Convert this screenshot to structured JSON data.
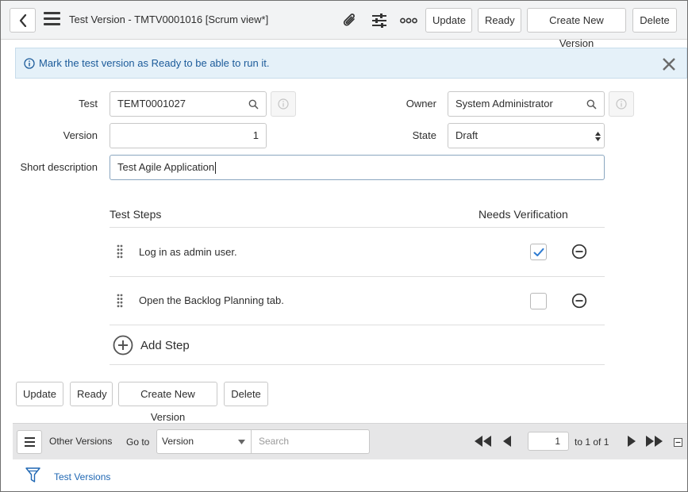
{
  "header": {
    "title": "Test Version - TMTV0001016 [Scrum view*]",
    "icons": [
      "back-icon",
      "hamburger-icon",
      "paperclip-icon",
      "settings-sliders-icon",
      "more-icon"
    ],
    "buttons": {
      "update": "Update",
      "ready": "Ready",
      "create_new_version": "Create New Version",
      "delete": "Delete"
    }
  },
  "banner": {
    "message": "Mark the test version as Ready to be able to run it.",
    "background": "#e5f1f9",
    "text_color": "#1c5b9a"
  },
  "form": {
    "test": {
      "label": "Test",
      "value": "TEMT0001027"
    },
    "owner": {
      "label": "Owner",
      "value": "System Administrator"
    },
    "version": {
      "label": "Version",
      "value": "1"
    },
    "state": {
      "label": "State",
      "value": "Draft"
    },
    "short_description": {
      "label": "Short description",
      "value": "Test Agile Application"
    }
  },
  "steps": {
    "header_steps": "Test Steps",
    "header_verification": "Needs Verification",
    "items": [
      {
        "text": "Log in as admin user.",
        "needs_verification": true
      },
      {
        "text": "Open the Backlog Planning tab.",
        "needs_verification": false
      }
    ],
    "add_label": "Add Step",
    "check_color": "#2e7bd1"
  },
  "footer_buttons": {
    "update": "Update",
    "ready": "Ready",
    "create_new_version": "Create New Version",
    "delete": "Delete"
  },
  "related_list": {
    "title": "Other Versions",
    "goto_label": "Go to",
    "goto_field": "Version",
    "search_placeholder": "Search",
    "page_value": "1",
    "page_range": "to 1 of 1",
    "filter_link": "Test Versions",
    "link_color": "#1f67b3"
  }
}
